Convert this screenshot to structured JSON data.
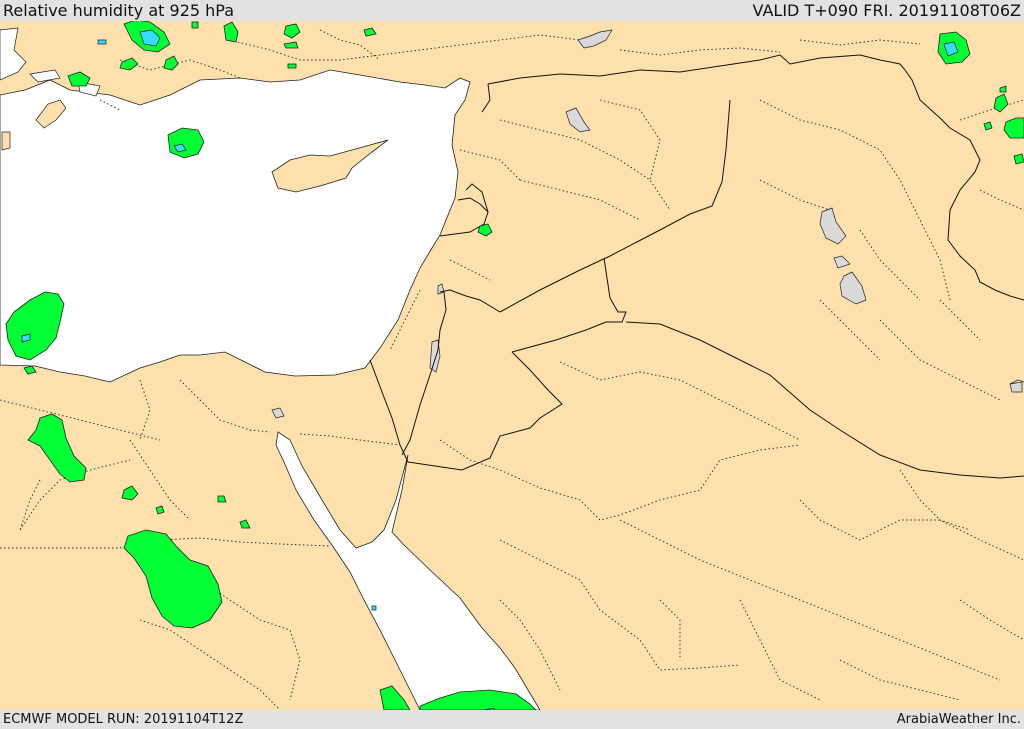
{
  "header": {
    "title": "Relative humidity at 925 hPa",
    "valid": "VALID T+090 FRI. 20191108T06Z"
  },
  "footer": {
    "run": "ECMWF MODEL RUN: 20191104T12Z",
    "credit": "ArabiaWeather Inc."
  },
  "colors": {
    "land": "#fde0ac",
    "water": "#ffffff",
    "lake": "#d9d9d9",
    "humidity_high": "#00ff33",
    "humidity_very_high": "#33ddff",
    "country_border": "#111111",
    "province_border": "#222222"
  }
}
